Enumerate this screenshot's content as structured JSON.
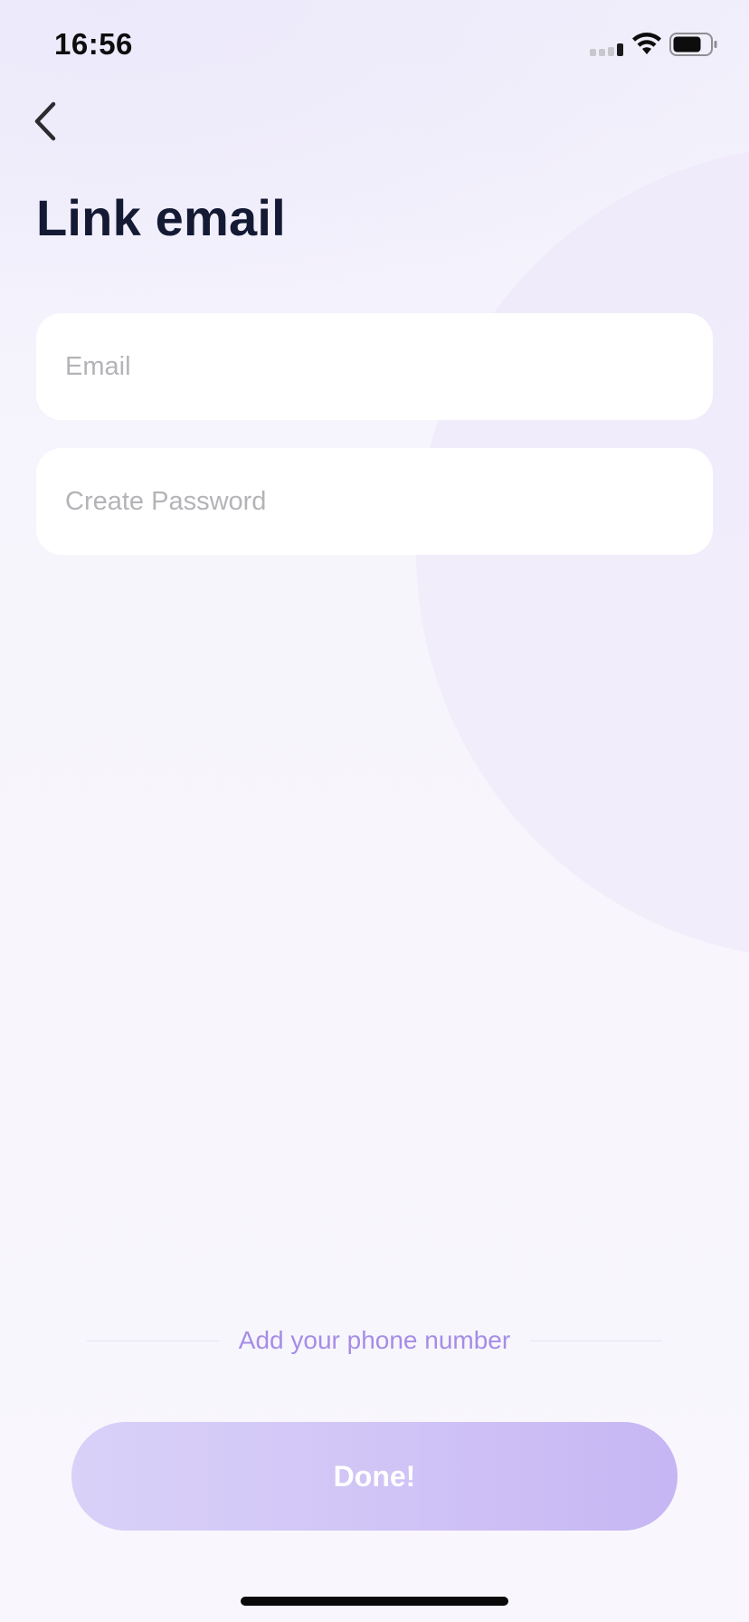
{
  "status_bar": {
    "time": "16:56",
    "icons": [
      "signal-icon",
      "wifi-icon",
      "battery-icon"
    ]
  },
  "header": {
    "back_icon": "chevron-left-icon",
    "title": "Link email"
  },
  "form": {
    "email": {
      "placeholder": "Email",
      "value": ""
    },
    "password": {
      "placeholder": "Create Password",
      "value": ""
    }
  },
  "phone_link": {
    "label": "Add your phone number"
  },
  "done_button": {
    "label": "Done!"
  },
  "colors": {
    "title": "#141a33",
    "accent": "#a58de6",
    "button_start": "#d9d1f8",
    "button_end": "#c6b6f4",
    "placeholder": "#b4b4b8"
  }
}
